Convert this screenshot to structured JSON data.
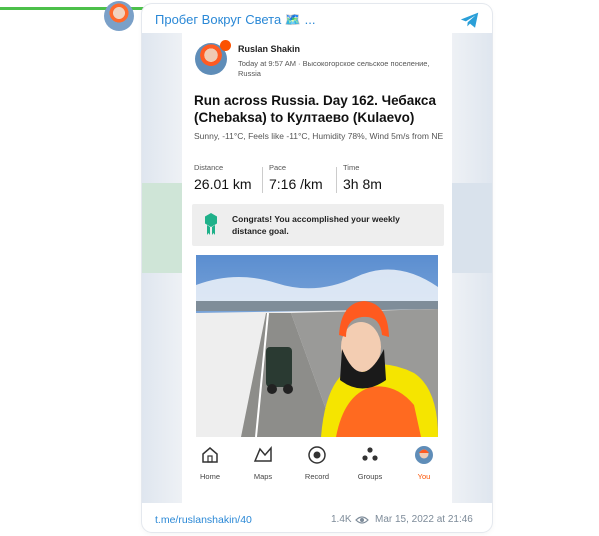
{
  "channel": {
    "title": "Пробег Вокруг Света 🗺️ ..."
  },
  "post": {
    "athlete": {
      "name": "Ruslan Shakin",
      "meta": "Today at 9:57 AM · Высокогорское сельское поселение, Russia"
    },
    "activity": {
      "title": "Run across Russia. Day 162. Чебакса (Chebaksa) to Култаево (Kulaevo)",
      "weather": "Sunny, -11°C, Feels like -11°C, Humidity 78%, Wind 5m/s from NE"
    },
    "stats": [
      {
        "label": "Distance",
        "value": "26.01 km"
      },
      {
        "label": "Pace",
        "value": "7:16 /km"
      },
      {
        "label": "Time",
        "value": "3h 8m"
      }
    ],
    "congrats": "Congrats! You accomplished your weekly distance goal.",
    "tabs": [
      {
        "label": "Home",
        "icon": "home-icon"
      },
      {
        "label": "Maps",
        "icon": "map-icon"
      },
      {
        "label": "Record",
        "icon": "record-icon"
      },
      {
        "label": "Groups",
        "icon": "groups-icon"
      },
      {
        "label": "You",
        "icon": "profile-icon",
        "active": true
      }
    ],
    "accent_color": "#fc5200"
  },
  "footer": {
    "link": "t.me/ruslanshakin/40",
    "views": "1.4K",
    "date": "Mar 15, 2022 at 21:46"
  }
}
